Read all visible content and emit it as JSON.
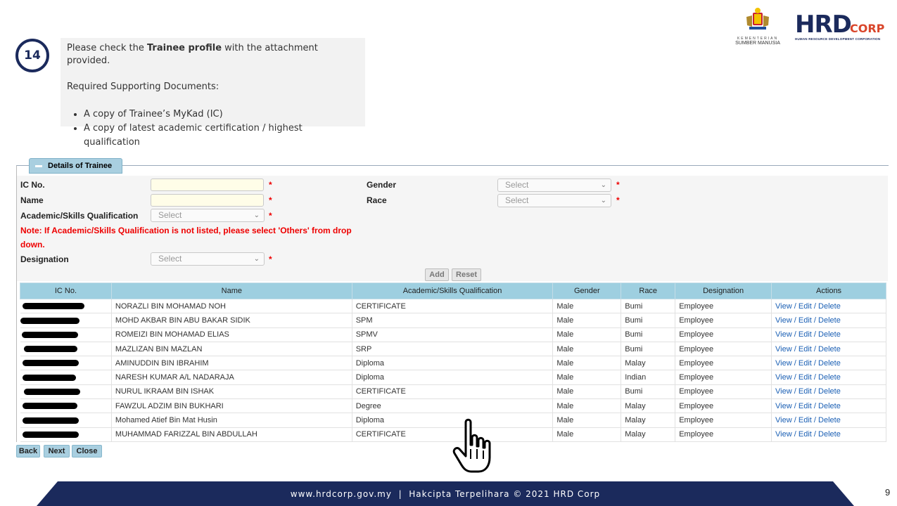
{
  "step": {
    "number": "14"
  },
  "instruction": {
    "line_prefix": "Please check the ",
    "line_bold": "Trainee profile",
    "line_suffix": " with the attachment provided.",
    "required_heading": "Required Supporting Documents:",
    "documents": [
      "A copy of Trainee’s MyKad (IC)",
      "A copy of latest academic certification / highest qualification"
    ]
  },
  "logos": {
    "crest_line1": "KEMENTERIAN",
    "crest_line2": "SUMBER MANUSIA",
    "hrd_word": "HRD",
    "corp_word": "CORP",
    "hrd_sub": "HUMAN RESOURCE DEVELOPMENT CORPORATION"
  },
  "panel": {
    "title": "Details of Trainee"
  },
  "form": {
    "ic_label": "IC No.",
    "name_label": "Name",
    "qualification_label": "Academic/Skills Qualification",
    "qualification_value": "Select",
    "gender_label": "Gender",
    "gender_value": "Select",
    "race_label": "Race",
    "race_value": "Select",
    "designation_label": "Designation",
    "designation_value": "Select",
    "required_mark": "*",
    "note": "Note: If Academic/Skills Qualification is not listed, please select 'Others' from drop down.",
    "add_label": "Add",
    "reset_label": "Reset"
  },
  "table": {
    "headers": [
      "IC No.",
      "Name",
      "Academic/Skills Qualification",
      "Gender",
      "Race",
      "Designation",
      "Actions"
    ],
    "actions": {
      "view": "View",
      "edit": "Edit",
      "delete": "Delete",
      "sep": " / "
    },
    "rows": [
      {
        "name": "NORAZLI BIN MOHAMAD NOH",
        "qualification": "CERTIFICATE",
        "gender": "Male",
        "race": "Bumi",
        "designation": "Employee"
      },
      {
        "name": "MOHD AKBAR BIN ABU BAKAR SIDIK",
        "qualification": "SPM",
        "gender": "Male",
        "race": "Bumi",
        "designation": "Employee"
      },
      {
        "name": "ROMEIZI BIN MOHAMAD ELIAS",
        "qualification": "SPMV",
        "gender": "Male",
        "race": "Bumi",
        "designation": "Employee"
      },
      {
        "name": "MAZLIZAN BIN MAZLAN",
        "qualification": "SRP",
        "gender": "Male",
        "race": "Bumi",
        "designation": "Employee"
      },
      {
        "name": "AMINUDDIN BIN IBRAHIM",
        "qualification": "Diploma",
        "gender": "Male",
        "race": "Malay",
        "designation": "Employee"
      },
      {
        "name": "NARESH KUMAR A/L NADARAJA",
        "qualification": "Diploma",
        "gender": "Male",
        "race": "Indian",
        "designation": "Employee"
      },
      {
        "name": "NURUL IKRAAM BIN ISHAK",
        "qualification": "CERTIFICATE",
        "gender": "Male",
        "race": "Bumi",
        "designation": "Employee"
      },
      {
        "name": "FAWZUL ADZIM BIN BUKHARI",
        "qualification": "Degree",
        "gender": "Male",
        "race": "Malay",
        "designation": "Employee"
      },
      {
        "name": "Mohamed Atief Bin Mat Husin",
        "qualification": "Diploma",
        "gender": "Male",
        "race": "Malay",
        "designation": "Employee"
      },
      {
        "name": "MUHAMMAD FARIZZAL BIN ABDULLAH",
        "qualification": "CERTIFICATE",
        "gender": "Male",
        "race": "Malay",
        "designation": "Employee"
      }
    ]
  },
  "nav": {
    "back": "Back",
    "next": "Next",
    "close": "Close"
  },
  "footer": {
    "text": "www.hrdcorp.gov.my  |  Hakcipta Terpelihara © 2021 HRD Corp"
  },
  "page_number": "9",
  "colors": {
    "brand_navy": "#1b2a5c",
    "brand_red": "#d9462b",
    "header_blue": "#9ecfe0",
    "link_blue": "#1a5fb4",
    "required_red": "#e00000"
  }
}
